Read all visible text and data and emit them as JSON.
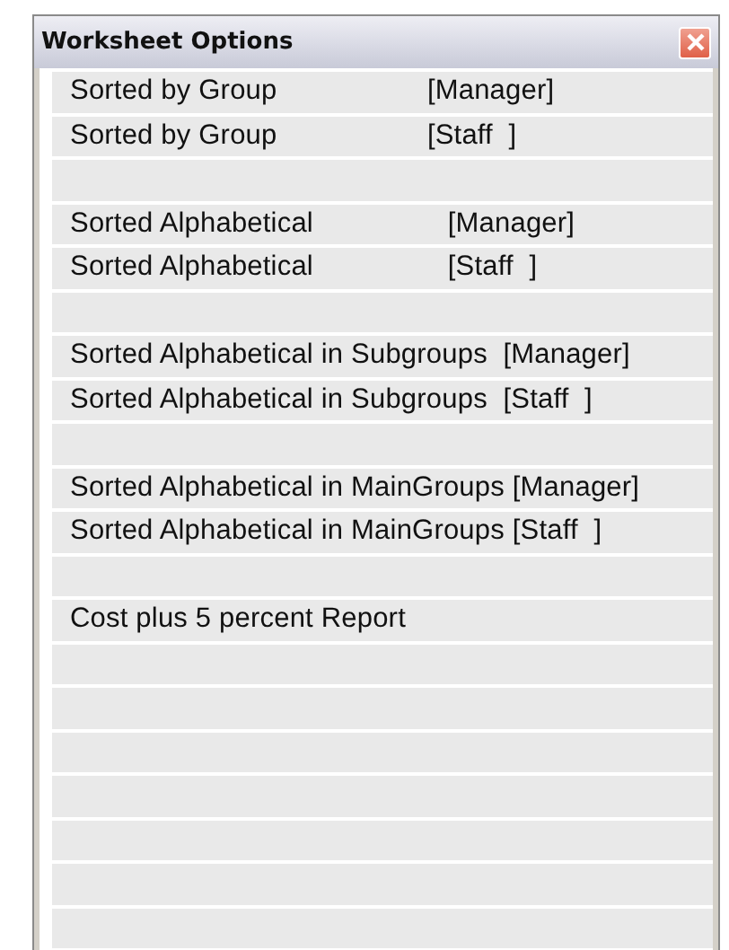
{
  "window": {
    "title": "Worksheet Options"
  },
  "rows": [
    {
      "kind": "option",
      "text": "Sorted by Group                   [Manager]"
    },
    {
      "kind": "option",
      "text": "Sorted by Group                   [Staff  ]"
    },
    {
      "kind": "blank"
    },
    {
      "kind": "option",
      "text": "Sorted Alphabetical                 [Manager]"
    },
    {
      "kind": "option",
      "text": "Sorted Alphabetical                 [Staff  ]"
    },
    {
      "kind": "blank"
    },
    {
      "kind": "option",
      "text": "Sorted Alphabetical in Subgroups  [Manager]"
    },
    {
      "kind": "option",
      "text": "Sorted Alphabetical in Subgroups  [Staff  ]"
    },
    {
      "kind": "blank"
    },
    {
      "kind": "option",
      "text": "Sorted Alphabetical in MainGroups [Manager]"
    },
    {
      "kind": "option",
      "text": "Sorted Alphabetical in MainGroups [Staff  ]"
    },
    {
      "kind": "blank"
    },
    {
      "kind": "option",
      "text": "Cost plus 5 percent Report"
    },
    {
      "kind": "blank"
    },
    {
      "kind": "blank"
    },
    {
      "kind": "blank"
    },
    {
      "kind": "blank"
    },
    {
      "kind": "blank"
    },
    {
      "kind": "blank"
    },
    {
      "kind": "blank"
    }
  ]
}
